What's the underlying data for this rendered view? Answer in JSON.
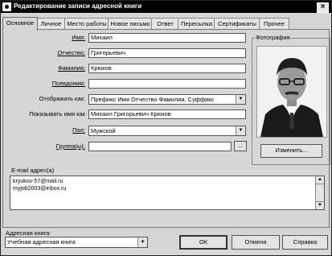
{
  "window": {
    "title": "Редактирование записи адресной книги",
    "close": "×"
  },
  "tabs": [
    "Основное",
    "Личное",
    "Место работы",
    "Новое письмо",
    "Ответ",
    "Пересылка",
    "Сертификаты",
    "Прочее"
  ],
  "form": {
    "first_name": {
      "label": "Имя:",
      "value": "Михаил"
    },
    "middle_name": {
      "label": "Отчество:",
      "value": "Григорьевич"
    },
    "last_name": {
      "label": "Фамилия:",
      "value": "Крюков"
    },
    "nickname": {
      "label": "Псевдоним:",
      "value": ""
    },
    "display_as": {
      "label": "Отображать как:",
      "value": "Префикс Имя Отчество Фамилия, Суффикс"
    },
    "show_name_as": {
      "label": "Показывать имя как",
      "value": "Михаил Григорьевич Крюков"
    },
    "gender": {
      "label": "Пол:",
      "value": "Мужской"
    },
    "groups": {
      "label": "Группа(ы):",
      "value": "",
      "browse": "..."
    }
  },
  "photo": {
    "title": "Фотография",
    "change_button": "Изменить..."
  },
  "email": {
    "label": "E-mail адрес(а)",
    "addresses": [
      "kryukov-57@mail.ru",
      "myjob2003@inbox.ru"
    ]
  },
  "address_book": {
    "label": "Адресная книга:",
    "value": "Учебная адресная книга"
  },
  "buttons": {
    "ok": "ОК",
    "cancel": "Отмена",
    "help": "Справка"
  }
}
